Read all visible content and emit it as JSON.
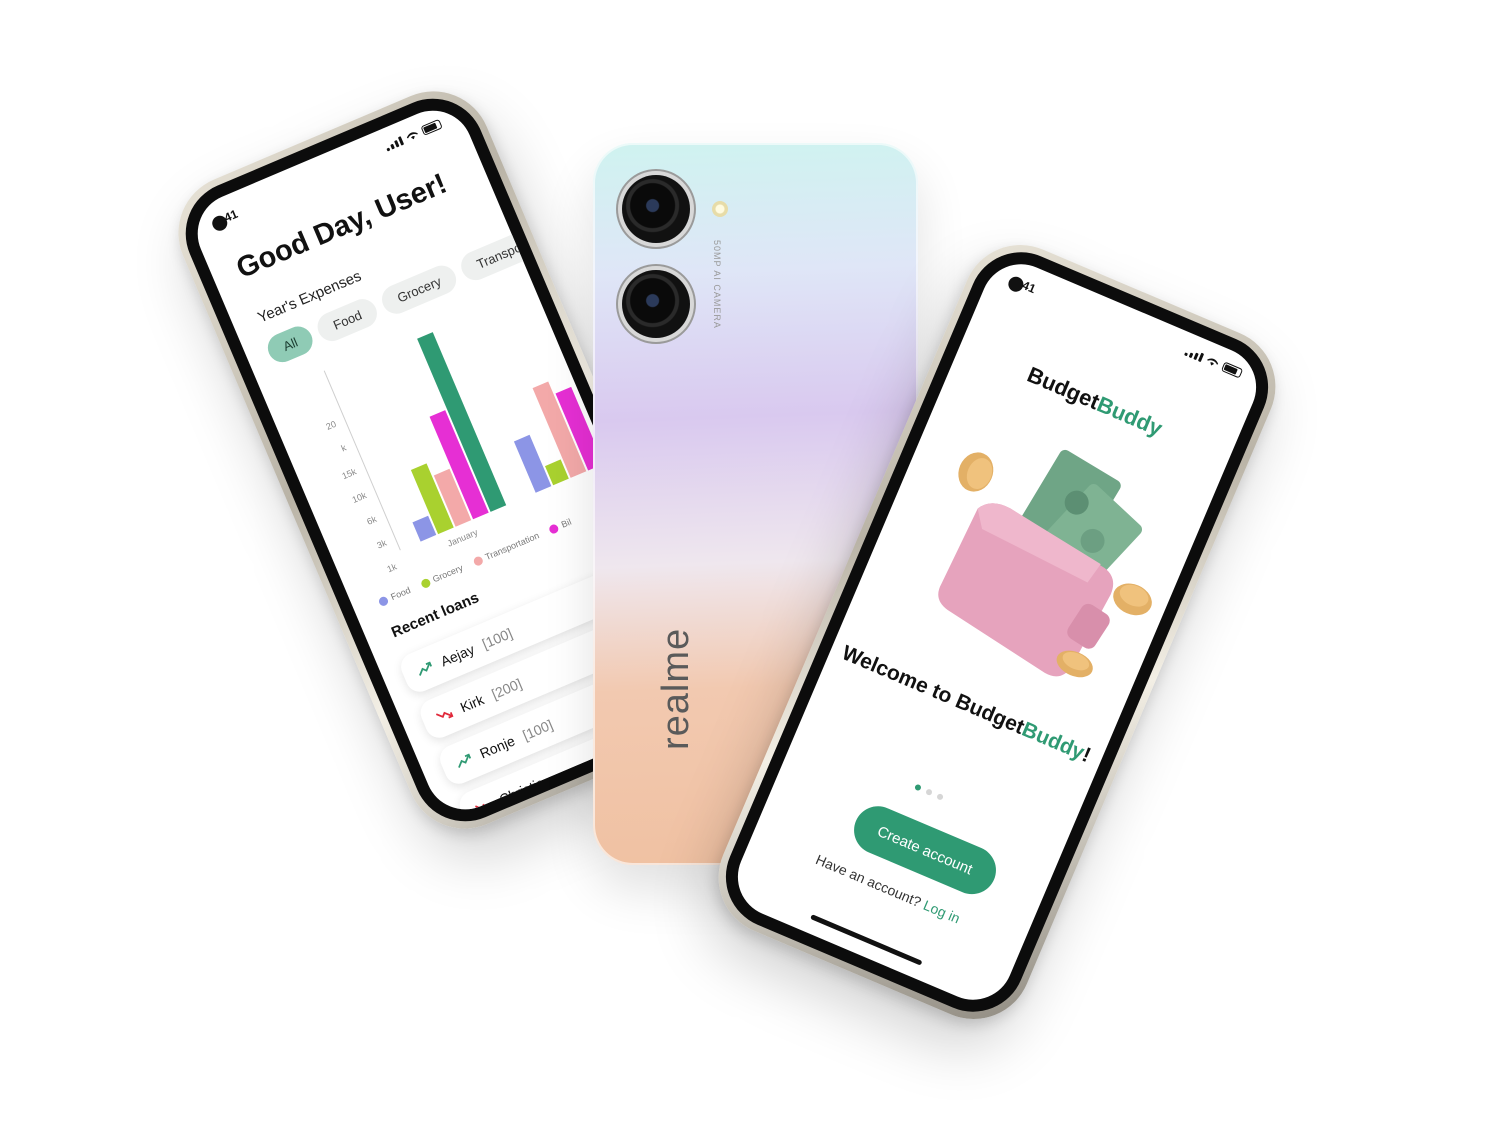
{
  "left_screen": {
    "status_time": "41",
    "greeting": "Good Day, User!",
    "section_title": "Year's Expenses",
    "filters": [
      {
        "label": "All",
        "active": true
      },
      {
        "label": "Food",
        "active": false
      },
      {
        "label": "Grocery",
        "active": false
      },
      {
        "label": "Transportatio",
        "active": false
      }
    ],
    "legend": [
      {
        "label": "Food",
        "color": "#8c95e6"
      },
      {
        "label": "Grocery",
        "color": "#a9d12f"
      },
      {
        "label": "Transportation",
        "color": "#f3a9a9"
      },
      {
        "label": "Bil",
        "color": "#e62fd4"
      }
    ],
    "loans_title": "Recent loans",
    "loans": [
      {
        "name": "Aejay",
        "amount": "[100]",
        "trend": "up"
      },
      {
        "name": "Kirk",
        "amount": "[200]",
        "trend": "down"
      },
      {
        "name": "Ronje",
        "amount": "[100]",
        "trend": "up"
      },
      {
        "name": "Christia",
        "amount": "",
        "trend": "down"
      }
    ],
    "colors": {
      "accent": "#2f9a73",
      "up": "#2f9a73",
      "down": "#e0283a"
    }
  },
  "chart_data": {
    "type": "bar",
    "title": "",
    "xlabel": "",
    "ylabel": "",
    "y_ticks": [
      "1k",
      "3k",
      "6k",
      "10k",
      "15k",
      "k",
      "20"
    ],
    "categories": [
      "January",
      ""
    ],
    "series": [
      {
        "name": "Food",
        "color": "#8c95e6",
        "values": [
          3,
          8
        ]
      },
      {
        "name": "Grocery",
        "color": "#a9d12f",
        "values": [
          10,
          3
        ]
      },
      {
        "name": "Transportation",
        "color": "#f3a9a9",
        "values": [
          8,
          14
        ]
      },
      {
        "name": "Bil",
        "color": "#e62fd4",
        "values": [
          16,
          12
        ]
      },
      {
        "name": "",
        "color": "#2f9a73",
        "values": [
          27,
          0
        ]
      }
    ],
    "grid": false,
    "legend_position": "bottom"
  },
  "center_phone": {
    "brand": "realme",
    "camera_text": "50MP AI CAMERA"
  },
  "right_screen": {
    "status_time": "41",
    "logo_part1": "Budget",
    "logo_part2": "Buddy",
    "welcome_prefix": "Welcome to Budget",
    "welcome_accent": "Buddy",
    "welcome_suffix": "!",
    "pager_total": 3,
    "pager_active": 0,
    "cta_label": "Create account",
    "login_prompt": "Have an account?",
    "login_link": "Log in",
    "colors": {
      "accent": "#2f9a73",
      "wallet": "#e6a3bd",
      "cash": "#7fb393",
      "coin": "#e3b066"
    }
  }
}
